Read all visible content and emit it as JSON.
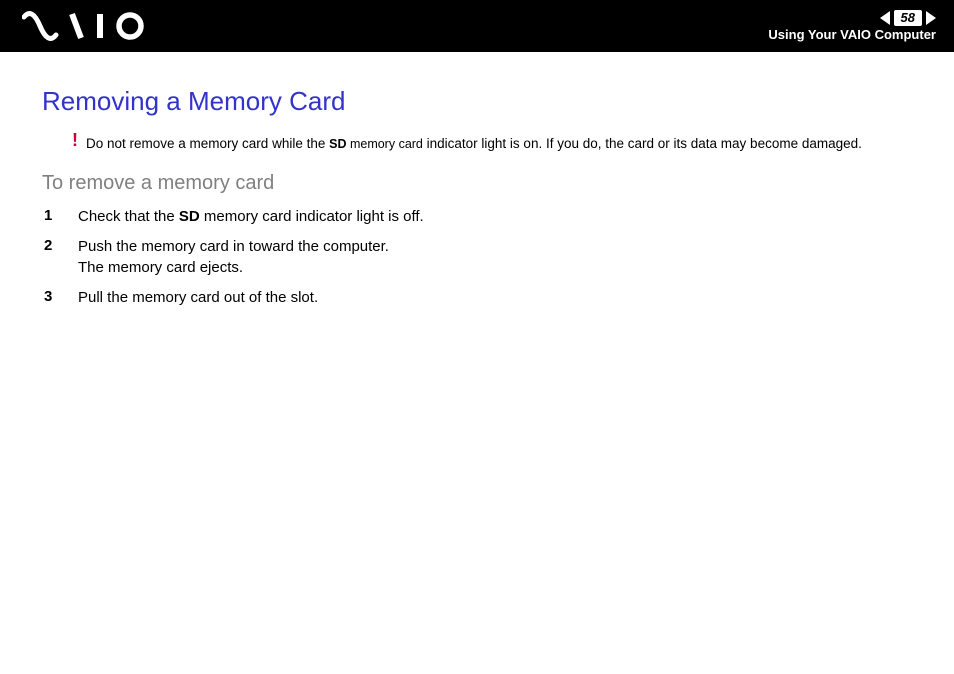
{
  "header": {
    "page_number": "58",
    "section_title": "Using Your VAIO Computer"
  },
  "content": {
    "title": "Removing a Memory Card",
    "warning": {
      "bang": "!",
      "pre": "Do not remove a memory card while the ",
      "bold_small": "SD",
      "small_after_bold": " memory card",
      "post": " indicator light is on. If you do, the card or its data may become damaged."
    },
    "subtitle": "To remove a memory card",
    "steps": [
      {
        "num": "1",
        "pre": "Check that the ",
        "bold": "SD",
        "post": " memory card indicator light is off."
      },
      {
        "num": "2",
        "line1": "Push the memory card in toward the computer.",
        "line2": "The memory card ejects."
      },
      {
        "num": "3",
        "text": "Pull the memory card out of the slot."
      }
    ]
  }
}
